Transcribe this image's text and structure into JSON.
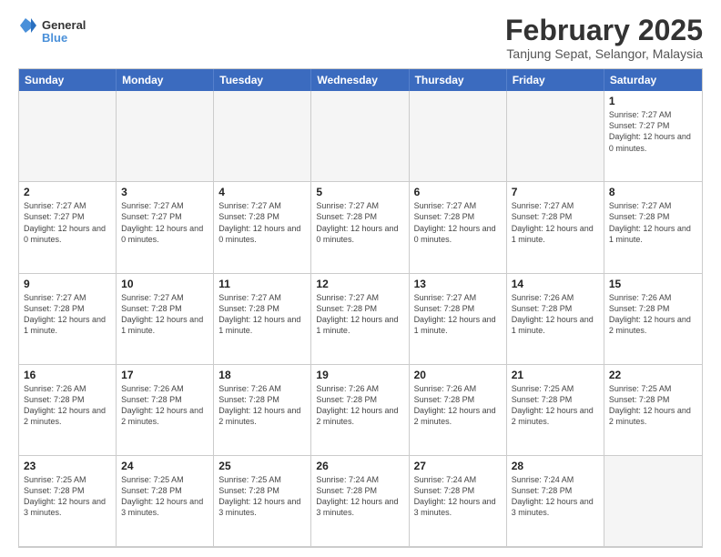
{
  "header": {
    "logo_general": "General",
    "logo_blue": "Blue",
    "title": "February 2025",
    "location": "Tanjung Sepat, Selangor, Malaysia"
  },
  "days_of_week": [
    "Sunday",
    "Monday",
    "Tuesday",
    "Wednesday",
    "Thursday",
    "Friday",
    "Saturday"
  ],
  "weeks": [
    [
      {
        "day": "",
        "empty": true
      },
      {
        "day": "",
        "empty": true
      },
      {
        "day": "",
        "empty": true
      },
      {
        "day": "",
        "empty": true
      },
      {
        "day": "",
        "empty": true
      },
      {
        "day": "",
        "empty": true
      },
      {
        "day": "1",
        "sunrise": "7:27 AM",
        "sunset": "7:27 PM",
        "daylight": "12 hours and 0 minutes."
      }
    ],
    [
      {
        "day": "2",
        "sunrise": "7:27 AM",
        "sunset": "7:27 PM",
        "daylight": "12 hours and 0 minutes."
      },
      {
        "day": "3",
        "sunrise": "7:27 AM",
        "sunset": "7:27 PM",
        "daylight": "12 hours and 0 minutes."
      },
      {
        "day": "4",
        "sunrise": "7:27 AM",
        "sunset": "7:28 PM",
        "daylight": "12 hours and 0 minutes."
      },
      {
        "day": "5",
        "sunrise": "7:27 AM",
        "sunset": "7:28 PM",
        "daylight": "12 hours and 0 minutes."
      },
      {
        "day": "6",
        "sunrise": "7:27 AM",
        "sunset": "7:28 PM",
        "daylight": "12 hours and 0 minutes."
      },
      {
        "day": "7",
        "sunrise": "7:27 AM",
        "sunset": "7:28 PM",
        "daylight": "12 hours and 1 minute."
      },
      {
        "day": "8",
        "sunrise": "7:27 AM",
        "sunset": "7:28 PM",
        "daylight": "12 hours and 1 minute."
      }
    ],
    [
      {
        "day": "9",
        "sunrise": "7:27 AM",
        "sunset": "7:28 PM",
        "daylight": "12 hours and 1 minute."
      },
      {
        "day": "10",
        "sunrise": "7:27 AM",
        "sunset": "7:28 PM",
        "daylight": "12 hours and 1 minute."
      },
      {
        "day": "11",
        "sunrise": "7:27 AM",
        "sunset": "7:28 PM",
        "daylight": "12 hours and 1 minute."
      },
      {
        "day": "12",
        "sunrise": "7:27 AM",
        "sunset": "7:28 PM",
        "daylight": "12 hours and 1 minute."
      },
      {
        "day": "13",
        "sunrise": "7:27 AM",
        "sunset": "7:28 PM",
        "daylight": "12 hours and 1 minute."
      },
      {
        "day": "14",
        "sunrise": "7:26 AM",
        "sunset": "7:28 PM",
        "daylight": "12 hours and 1 minute."
      },
      {
        "day": "15",
        "sunrise": "7:26 AM",
        "sunset": "7:28 PM",
        "daylight": "12 hours and 2 minutes."
      }
    ],
    [
      {
        "day": "16",
        "sunrise": "7:26 AM",
        "sunset": "7:28 PM",
        "daylight": "12 hours and 2 minutes."
      },
      {
        "day": "17",
        "sunrise": "7:26 AM",
        "sunset": "7:28 PM",
        "daylight": "12 hours and 2 minutes."
      },
      {
        "day": "18",
        "sunrise": "7:26 AM",
        "sunset": "7:28 PM",
        "daylight": "12 hours and 2 minutes."
      },
      {
        "day": "19",
        "sunrise": "7:26 AM",
        "sunset": "7:28 PM",
        "daylight": "12 hours and 2 minutes."
      },
      {
        "day": "20",
        "sunrise": "7:26 AM",
        "sunset": "7:28 PM",
        "daylight": "12 hours and 2 minutes."
      },
      {
        "day": "21",
        "sunrise": "7:25 AM",
        "sunset": "7:28 PM",
        "daylight": "12 hours and 2 minutes."
      },
      {
        "day": "22",
        "sunrise": "7:25 AM",
        "sunset": "7:28 PM",
        "daylight": "12 hours and 2 minutes."
      }
    ],
    [
      {
        "day": "23",
        "sunrise": "7:25 AM",
        "sunset": "7:28 PM",
        "daylight": "12 hours and 3 minutes."
      },
      {
        "day": "24",
        "sunrise": "7:25 AM",
        "sunset": "7:28 PM",
        "daylight": "12 hours and 3 minutes."
      },
      {
        "day": "25",
        "sunrise": "7:25 AM",
        "sunset": "7:28 PM",
        "daylight": "12 hours and 3 minutes."
      },
      {
        "day": "26",
        "sunrise": "7:24 AM",
        "sunset": "7:28 PM",
        "daylight": "12 hours and 3 minutes."
      },
      {
        "day": "27",
        "sunrise": "7:24 AM",
        "sunset": "7:28 PM",
        "daylight": "12 hours and 3 minutes."
      },
      {
        "day": "28",
        "sunrise": "7:24 AM",
        "sunset": "7:28 PM",
        "daylight": "12 hours and 3 minutes."
      },
      {
        "day": "",
        "empty": true
      }
    ]
  ]
}
